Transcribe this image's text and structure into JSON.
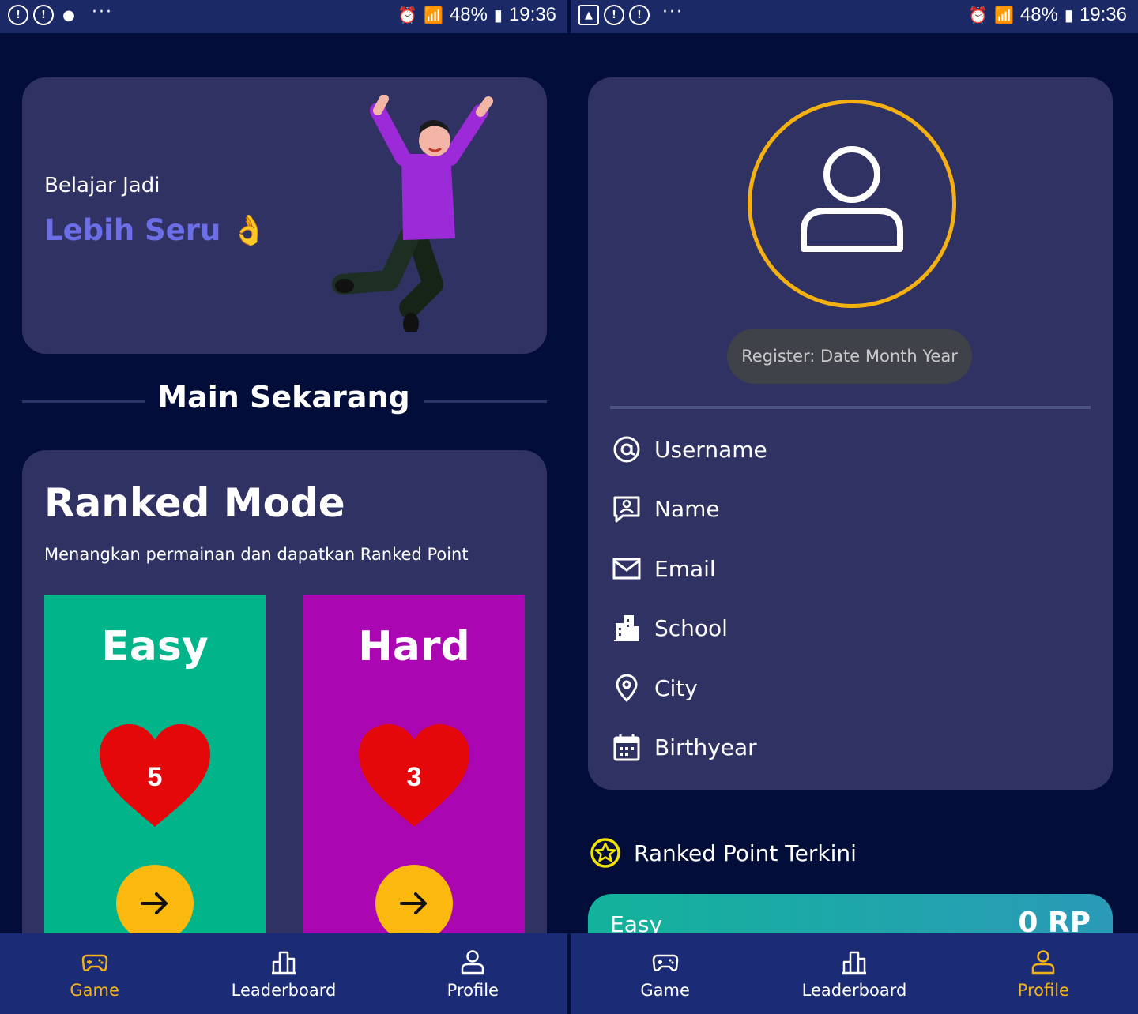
{
  "left_screen": {
    "status": {
      "battery": "48%",
      "time": "19:36"
    },
    "hero": {
      "line1": "Belajar Jadi",
      "line2": "Lebih Seru 👌"
    },
    "section_title": "Main Sekarang",
    "ranked": {
      "title": "Ranked Mode",
      "subtitle": "Menangkan permainan dan dapatkan Ranked Point",
      "modes": [
        {
          "label": "Easy",
          "lives": "5",
          "color": "#02b48a"
        },
        {
          "label": "Hard",
          "lives": "3",
          "color": "#aa07b3"
        }
      ]
    },
    "nav": {
      "active": "Game",
      "items": [
        "Game",
        "Leaderboard",
        "Profile"
      ]
    }
  },
  "right_screen": {
    "status": {
      "battery": "48%",
      "time": "19:36"
    },
    "profile": {
      "register": "Register: Date Month Year",
      "fields": [
        {
          "icon": "at-icon",
          "label": "Username"
        },
        {
          "icon": "id-card-icon",
          "label": "Name"
        },
        {
          "icon": "mail-icon",
          "label": "Email"
        },
        {
          "icon": "building-icon",
          "label": "School"
        },
        {
          "icon": "location-pin-icon",
          "label": "City"
        },
        {
          "icon": "calendar-icon",
          "label": "Birthyear"
        }
      ]
    },
    "ranked_point": {
      "title": "Ranked Point Terkini",
      "mode": "Easy",
      "value": "0 RP"
    },
    "nav": {
      "active": "Profile",
      "items": [
        "Game",
        "Leaderboard",
        "Profile"
      ]
    }
  },
  "colors": {
    "background": "#020d3a",
    "card": "#313264",
    "accent": "#f2b21c",
    "nav": "#1c2b76",
    "heart": "#e5080a"
  }
}
